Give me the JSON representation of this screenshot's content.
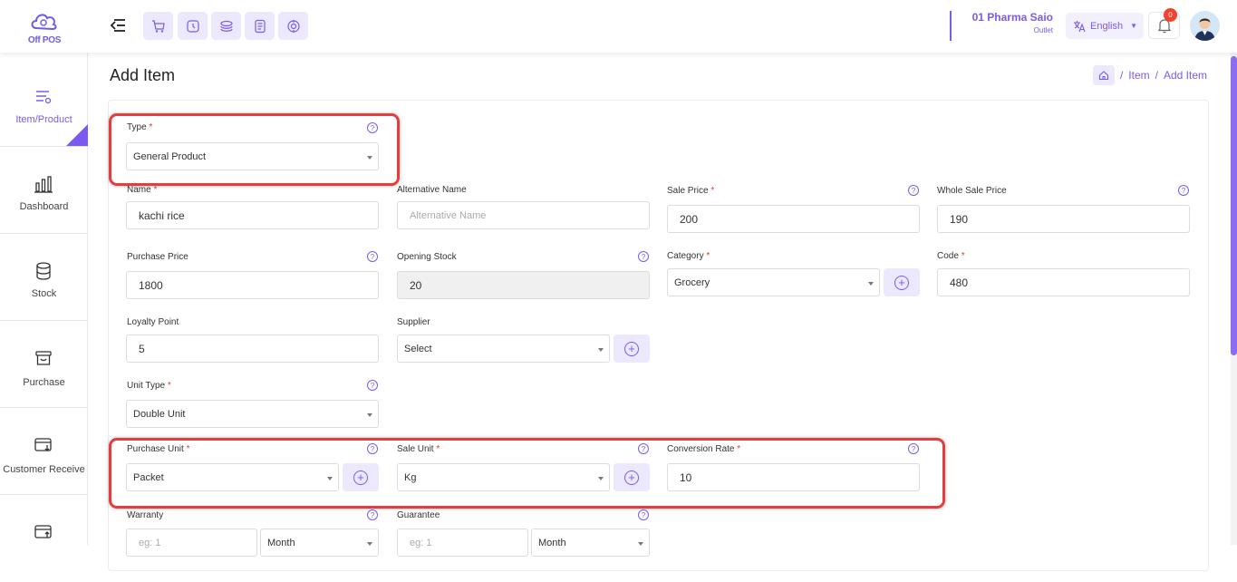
{
  "app": {
    "logo_text": "Off POS"
  },
  "header": {
    "outlet_name": "01 Pharma Saio",
    "outlet_sub": "Outlet",
    "language": "English",
    "notification_count": "0"
  },
  "sidebar": {
    "items": [
      {
        "label": "Item/Product"
      },
      {
        "label": "Dashboard"
      },
      {
        "label": "Stock"
      },
      {
        "label": "Purchase"
      },
      {
        "label": "Customer Receive"
      }
    ]
  },
  "page": {
    "title": "Add Item",
    "breadcrumb": [
      "Item",
      "Add Item"
    ],
    "sep": "/"
  },
  "form": {
    "required_mark": "*",
    "help_glyph": "?",
    "type": {
      "label": "Type",
      "value": "General Product"
    },
    "name": {
      "label": "Name",
      "value": "kachi rice"
    },
    "alt_name": {
      "label": "Alternative Name",
      "placeholder": "Alternative Name"
    },
    "sale_price": {
      "label": "Sale Price",
      "value": "200"
    },
    "whole_sale_price": {
      "label": "Whole Sale Price",
      "value": "190"
    },
    "purchase_price": {
      "label": "Purchase Price",
      "value": "1800"
    },
    "opening_stock": {
      "label": "Opening Stock",
      "value": "20"
    },
    "category": {
      "label": "Category",
      "value": "Grocery"
    },
    "code": {
      "label": "Code",
      "value": "480"
    },
    "loyalty_point": {
      "label": "Loyalty Point",
      "value": "5"
    },
    "supplier": {
      "label": "Supplier",
      "value": "Select"
    },
    "unit_type": {
      "label": "Unit Type",
      "value": "Double Unit"
    },
    "purchase_unit": {
      "label": "Purchase Unit",
      "value": "Packet"
    },
    "sale_unit": {
      "label": "Sale Unit",
      "value": "Kg"
    },
    "conversion_rate": {
      "label": "Conversion Rate",
      "value": "10"
    },
    "warranty": {
      "label": "Warranty",
      "placeholder": "eg: 1",
      "period": "Month"
    },
    "guarantee": {
      "label": "Guarantee",
      "placeholder": "eg: 1",
      "period": "Month"
    }
  },
  "colors": {
    "accent": "#7a5af0",
    "highlight": "#e53d3d",
    "accent_soft": "#ece8fd"
  }
}
